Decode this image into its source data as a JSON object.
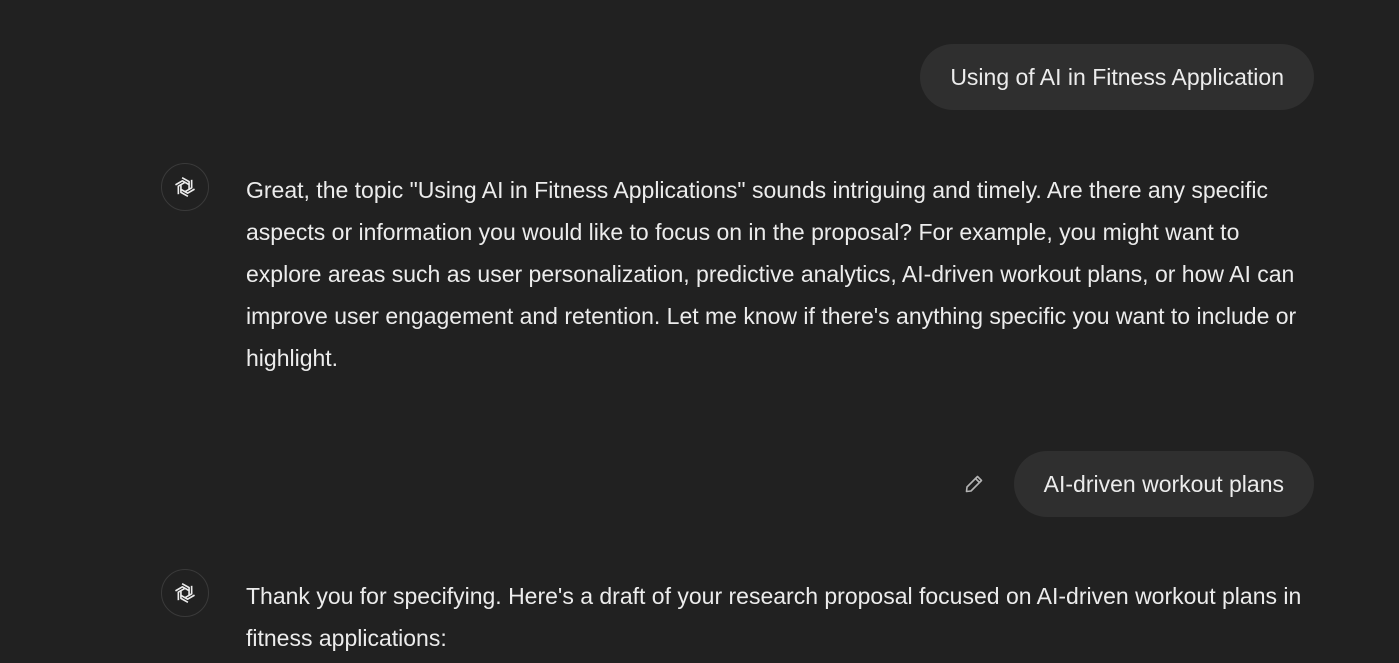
{
  "messages": {
    "user_1": "Using of AI in Fitness Application",
    "assistant_1": "Great, the topic \"Using AI in Fitness Applications\" sounds intriguing and timely. Are there any specific aspects or information you would like to focus on in the proposal? For example, you might want to explore areas such as user personalization, predictive analytics, AI-driven workout plans, or how AI can improve user engagement and retention. Let me know if there's anything specific you want to include or highlight.",
    "user_2": "AI-driven workout plans",
    "assistant_2": "Thank you for specifying. Here's a draft of your research proposal focused on AI-driven workout plans in fitness applications:"
  },
  "icons": {
    "assistant_avatar": "openai-logo-icon",
    "edit": "pencil-icon"
  }
}
